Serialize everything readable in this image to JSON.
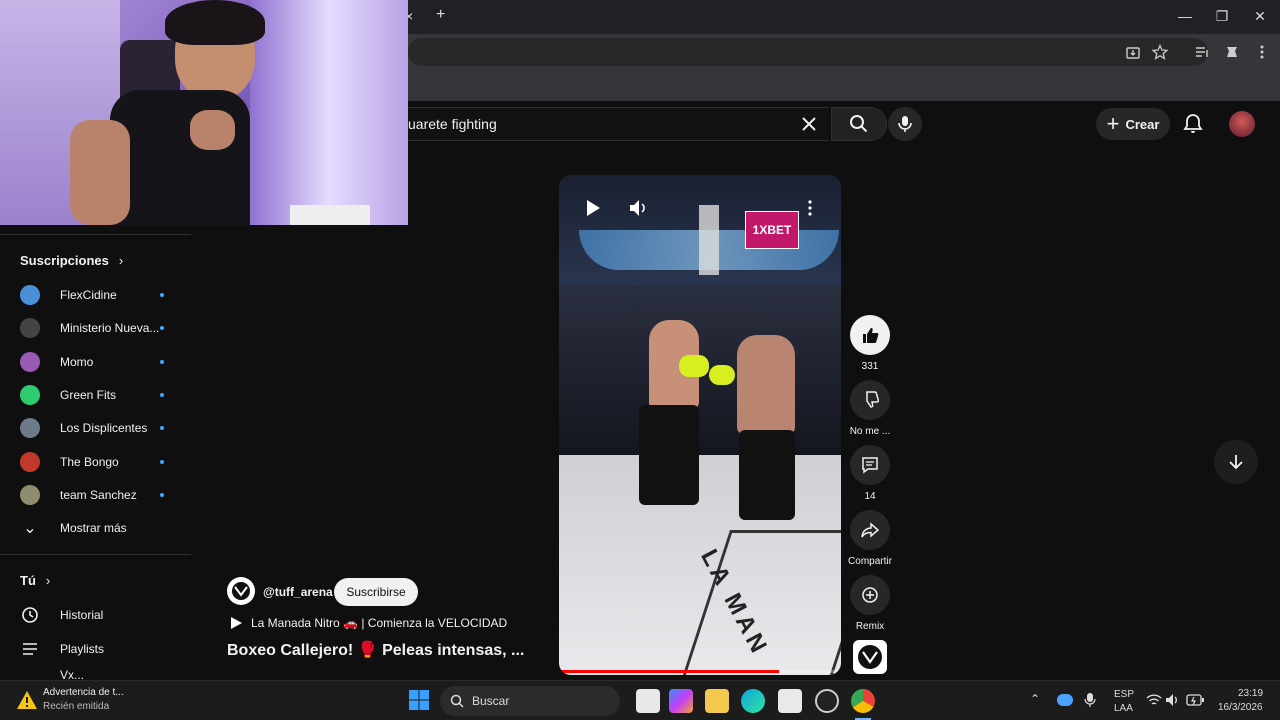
{
  "browser": {
    "new_tab_glyph": "+",
    "close_tab_glyph": "×",
    "minimize_glyph": "—",
    "restore_glyph": "❐",
    "close_glyph": "✕"
  },
  "header": {
    "search_query": "uarete fighting",
    "create_label": "Crear"
  },
  "sidebar": {
    "subscriptions_title": "Suscripciones",
    "subscriptions": [
      {
        "name": "FlexCidine",
        "color": "#4a90d9"
      },
      {
        "name": "Ministerio Nueva...",
        "color": "#444444"
      },
      {
        "name": "Momo",
        "color": "#9b59b6"
      },
      {
        "name": "Green Fits",
        "color": "#2ecc71"
      },
      {
        "name": "Los Displicentes",
        "color": "#6c7a89"
      },
      {
        "name": "The Bongo",
        "color": "#c0392b"
      },
      {
        "name": "team Sanchez",
        "color": "#8e8e6e"
      }
    ],
    "show_more": "Mostrar más",
    "you_title": "Tú",
    "history": "Historial",
    "playlists": "Playlists",
    "truncated_item": "Vx..."
  },
  "short": {
    "banner_text": "1XBET",
    "channel": "@tuff_arena",
    "subscribe": "Suscribirse",
    "music_line": "La Manada Nitro 🚗 | Comienza la VELOCIDAD",
    "title": "Boxeo Callejero! 🥊 Peleas intensas, ...",
    "floor_text": "LA MAN",
    "progress_fraction": 0.78
  },
  "actions": {
    "likes": "331",
    "dislike": "No me ...",
    "comments": "14",
    "share": "Compartir",
    "remix": "Remix"
  },
  "notification": {
    "title": "Advertencia de t...",
    "subtitle": "Recién emitida"
  },
  "taskbar": {
    "search": "Buscar",
    "lang_top": "ESP",
    "lang_bottom": "LAA",
    "time": "23:19",
    "date": "16/3/2026"
  }
}
